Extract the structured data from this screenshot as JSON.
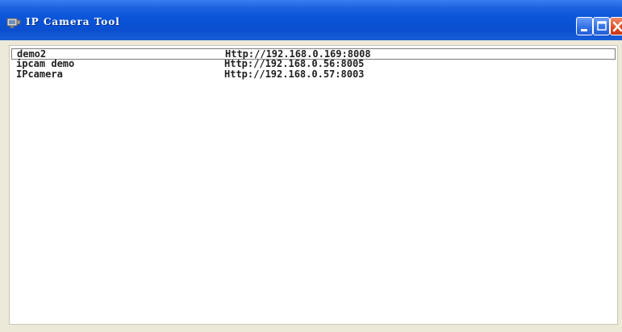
{
  "window": {
    "title": "IP Camera Tool"
  },
  "device_list": {
    "rows": [
      {
        "name": "demo2",
        "url": "Http://192.168.0.169:8008",
        "selected": true
      },
      {
        "name": "ipcam demo",
        "url": "Http://192.168.0.56:8005",
        "selected": false
      },
      {
        "name": "IPcamera",
        "url": "Http://192.168.0.57:8003",
        "selected": false
      }
    ]
  },
  "icons": {
    "app": "camera-tool-icon",
    "minimize": "minimize-icon",
    "maximize": "maximize-icon",
    "close": "close-icon"
  },
  "colors": {
    "titlebar": "#0b4fcf",
    "close_button": "#e04a22",
    "window_face": "#ece9d8",
    "list_background": "#ffffff"
  }
}
